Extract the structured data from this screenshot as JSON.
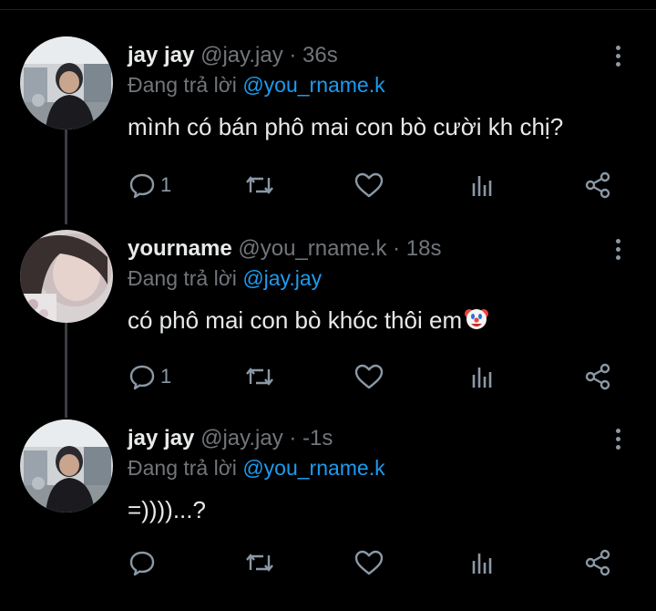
{
  "tweets": [
    {
      "name": "jay jay",
      "meta": "@jay.jay · 36s",
      "reply_prefix": "Đang trả lời",
      "reply_to": "@you_rname.k",
      "text": "mình có bán phô mai con bò cười kh chị?",
      "reply_count": "1",
      "avatar": "boy-selfie-avatar"
    },
    {
      "name": "yourname",
      "meta": "@you_rname.k · 18s",
      "reply_prefix": "Đang trả lời",
      "reply_to": "@jay.jay",
      "text": "có phô mai con bò khóc thôi em",
      "emoji": "clown-face-emoji",
      "reply_count": "1",
      "avatar": "girl-selfie-avatar"
    },
    {
      "name": "jay jay",
      "meta": "@jay.jay · -1s",
      "reply_prefix": "Đang trả lời",
      "reply_to": "@you_rname.k",
      "text": "=))))...?",
      "reply_count": "",
      "avatar": "boy-selfie-avatar"
    }
  ],
  "icons": [
    "reply-icon",
    "retweet-icon",
    "like-icon",
    "views-icon",
    "share-icon",
    "more-options-icon"
  ],
  "colors": {
    "background": "#000000",
    "link": "#1d9bf0",
    "muted": "#71767b",
    "text": "#e7e9ea"
  }
}
